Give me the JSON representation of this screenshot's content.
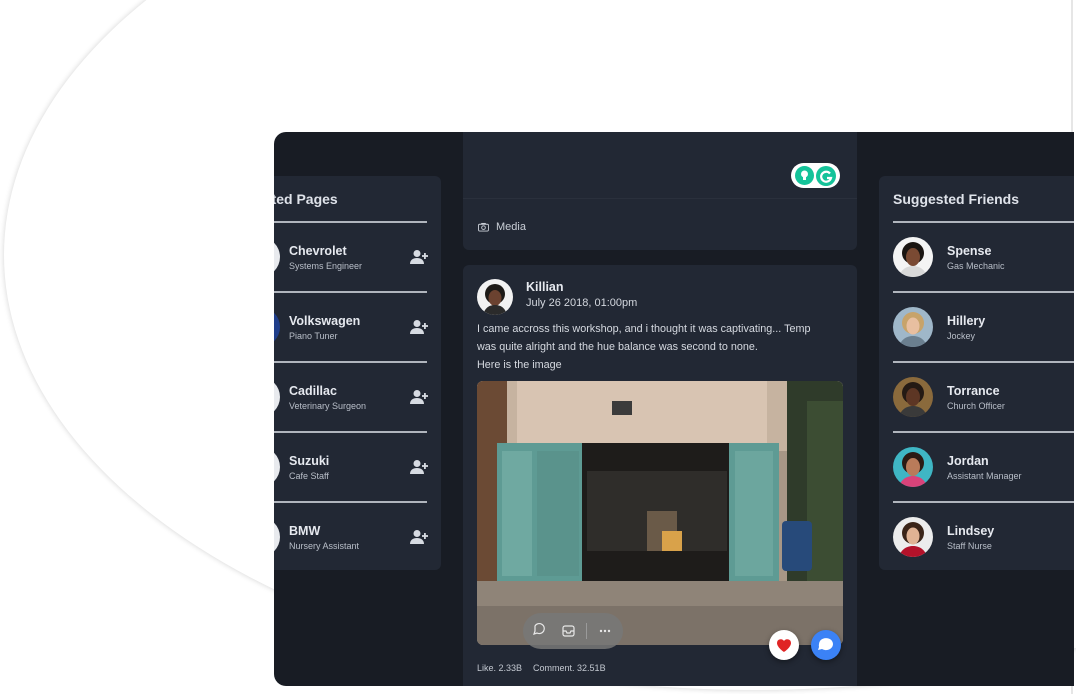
{
  "suggested_pages": {
    "title": "Suggested Pages",
    "visible_title": "ested Pages",
    "items": [
      {
        "name": "Chevrolet",
        "subtitle": "Systems Engineer"
      },
      {
        "name": "Volkswagen",
        "subtitle": "Piano Tuner"
      },
      {
        "name": "Cadillac",
        "subtitle": "Veterinary Surgeon"
      },
      {
        "name": "Suzuki",
        "subtitle": "Cafe Staff"
      },
      {
        "name": "BMW",
        "subtitle": "Nursery Assistant"
      }
    ]
  },
  "composer": {
    "media_label": "Media"
  },
  "post": {
    "author": "Killian",
    "date": "July 26 2018, 01:00pm",
    "text_lines": [
      "I came accross this workshop, and i thought it was captivating... Temp",
      "was quite alright and the hue balance was second to none.",
      "Here is the image"
    ],
    "likes": "Like. 2.33B",
    "comments": "Comment. 32.51B"
  },
  "suggested_friends": {
    "title": "Suggested Friends",
    "items": [
      {
        "name": "Spense",
        "subtitle": "Gas Mechanic"
      },
      {
        "name": "Hillery",
        "subtitle": "Jockey"
      },
      {
        "name": "Torrance",
        "subtitle": "Church Officer"
      },
      {
        "name": "Jordan",
        "subtitle": "Assistant Manager"
      },
      {
        "name": "Lindsey",
        "subtitle": "Staff Nurse"
      }
    ]
  },
  "icons": {
    "add": "user-plus-icon",
    "camera": "camera-icon",
    "heart": "heart-icon",
    "comment": "speech-bubble-icon",
    "grammarly": "grammarly-icon"
  },
  "colors": {
    "background": "#181c24",
    "panel": "#222834",
    "accent_blue": "#3b82f6",
    "heart_red": "#e02424",
    "grammarly_green": "#15c39a"
  }
}
